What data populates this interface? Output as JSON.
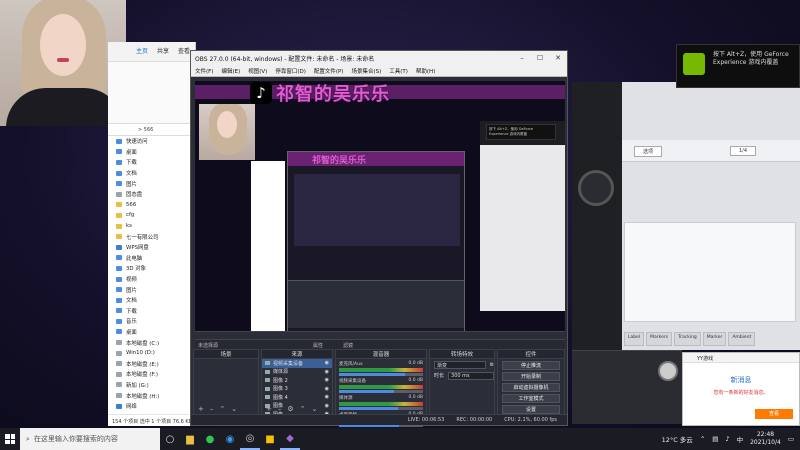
{
  "webcam": {
    "label": "webcam overlay"
  },
  "explorer": {
    "ribbon_tabs": [
      "主页",
      "共享",
      "查看"
    ],
    "address": "> 566",
    "quick_access": "快速访问",
    "items": [
      {
        "label": "桌面",
        "icon": "desktop"
      },
      {
        "label": "下载",
        "icon": "download"
      },
      {
        "label": "文档",
        "icon": "doc"
      },
      {
        "label": "图片",
        "icon": "pic"
      },
      {
        "label": "固态盘",
        "icon": "drive"
      },
      {
        "label": "566",
        "icon": "folder"
      },
      {
        "label": "cfg",
        "icon": "folder"
      },
      {
        "label": "ks",
        "icon": "folder"
      },
      {
        "label": "七一有限公司",
        "icon": "folder"
      },
      {
        "label": "WPS网盘",
        "icon": "net"
      },
      {
        "label": "此电脑",
        "icon": "pc"
      },
      {
        "label": "3D 对象",
        "icon": "3d"
      },
      {
        "label": "视频",
        "icon": "video"
      },
      {
        "label": "图片",
        "icon": "pic"
      },
      {
        "label": "文档",
        "icon": "doc"
      },
      {
        "label": "下载",
        "icon": "download"
      },
      {
        "label": "音乐",
        "icon": "music"
      },
      {
        "label": "桌面",
        "icon": "desktop"
      },
      {
        "label": "本地磁盘 (C:)",
        "icon": "drive"
      },
      {
        "label": "Win10 (D:)",
        "icon": "drive"
      },
      {
        "label": "本地磁盘 (E:)",
        "icon": "drive"
      },
      {
        "label": "本地磁盘 (F:)",
        "icon": "drive"
      },
      {
        "label": "新加 (G:)",
        "icon": "drive"
      },
      {
        "label": "本地磁盘 (H:)",
        "icon": "drive"
      },
      {
        "label": "网络",
        "icon": "net"
      }
    ],
    "status": "154 个项目  选中 1 个项目  76.6 KB"
  },
  "obs": {
    "title": "OBS 27.0.0 (64-bit, windows) - 配置文件: 未命名 - 场景: 未命名",
    "menu": [
      "文件(F)",
      "编辑(E)",
      "视图(V)",
      "停靠窗口(D)",
      "配置文件(P)",
      "场景集合(S)",
      "工具(T)",
      "帮助(H)"
    ],
    "banner": "祁智的吴乐乐",
    "no_source_selected": "未选择源",
    "properties": "属性",
    "filters": "滤镜",
    "docks": {
      "scenes": {
        "title": "场景",
        "items": [
          "场景"
        ]
      },
      "sources": {
        "title": "来源",
        "items": [
          {
            "label": "视频采集设备",
            "selected": true
          },
          {
            "label": "媒体源",
            "selected": false
          },
          {
            "label": "图像 2",
            "selected": false
          },
          {
            "label": "图像 3",
            "selected": false
          },
          {
            "label": "图像 4",
            "selected": false
          },
          {
            "label": "图像",
            "selected": false
          },
          {
            "label": "图像",
            "selected": false
          }
        ]
      },
      "mixer": {
        "title": "混音器",
        "channels": [
          {
            "name": "麦克风/Aux",
            "db": "0.0 dB",
            "level": 0.78
          },
          {
            "name": "视频采集设备",
            "db": "0.0 dB",
            "level": 0.65
          },
          {
            "name": "媒体源",
            "db": "0.0 dB",
            "level": 0.7
          },
          {
            "name": "桌面音频",
            "db": "0.0 dB",
            "level": 0.72
          }
        ]
      },
      "transitions": {
        "title": "转场特效",
        "type": "渐变",
        "duration_label": "时长",
        "duration": "300 ms"
      },
      "controls": {
        "title": "控件",
        "buttons": [
          "停止推流",
          "开始录制",
          "启动虚拟摄像机",
          "工作室模式",
          "设置",
          "退出"
        ]
      }
    },
    "status": {
      "live": "LIVE: 00:06:53",
      "rec": "REC: 00:00:00",
      "cpu": "CPU: 2.1%, 60.00 fps"
    }
  },
  "nvidia": {
    "line1": "按下 Alt+Z，使用 GeForce",
    "line2": "Experience 游戏内覆盖"
  },
  "audioapp": {
    "tabs": [
      "Label",
      "Markers",
      "Tracking",
      "Marker",
      "Ambient"
    ],
    "dropdown1": "选项",
    "dropdown2": "1/4"
  },
  "yy": {
    "app": "YY游戏",
    "title": "新消息",
    "line1": "您有一条新的好友消息。",
    "btn": "查看"
  },
  "taskbar": {
    "search_placeholder": "在这里输入你要搜索的内容",
    "weather": "12°C 多云",
    "ime": "中",
    "time": "22:48",
    "date": "2021/10/4"
  },
  "colors": {
    "obs_bg": "#2b2e38",
    "accent_magenta": "#e05bd4",
    "selection": "#3c5f95",
    "nvidia_green": "#76b900"
  }
}
